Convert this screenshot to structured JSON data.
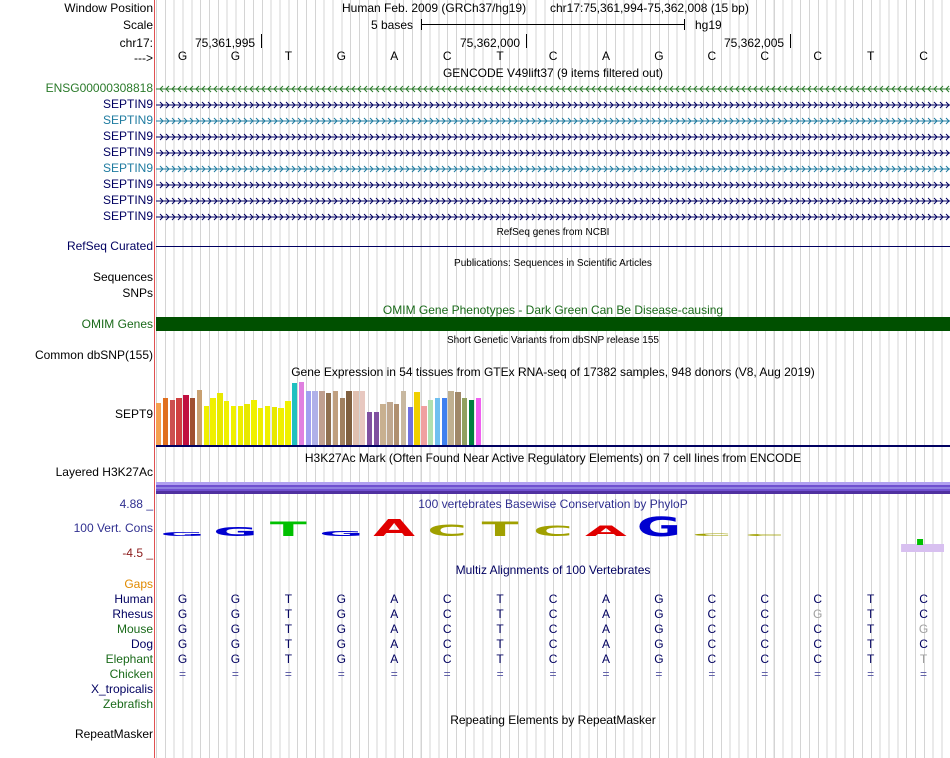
{
  "labels": {
    "window_position": "Window Position",
    "scale": "Scale",
    "chrom": "chr17:",
    "strand": "--->",
    "assembly": "Human Feb. 2009 (GRCh37/hg19)",
    "coords": "chr17:75,361,994-75,362,008 (15 bp)",
    "scale_text": "5 bases",
    "db": "hg19",
    "pos1": "75,361,995",
    "pos2": "75,362,000",
    "pos3": "75,362,005"
  },
  "sequence": [
    "G",
    "G",
    "T",
    "G",
    "A",
    "C",
    "T",
    "C",
    "A",
    "G",
    "C",
    "C",
    "C",
    "T",
    "C"
  ],
  "gencode": {
    "title": "GENCODE V49lift37 (9 items filtered out)",
    "items": [
      {
        "name": "ENSG00000308818",
        "color": "#2a7a2a"
      },
      {
        "name": "SEPTIN9",
        "color": "#000060"
      },
      {
        "name": "SEPTIN9",
        "color": "#1e7ba0"
      },
      {
        "name": "SEPTIN9",
        "color": "#000060"
      },
      {
        "name": "SEPTIN9",
        "color": "#000060"
      },
      {
        "name": "SEPTIN9",
        "color": "#1e7ba0"
      },
      {
        "name": "SEPTIN9",
        "color": "#000060"
      },
      {
        "name": "SEPTIN9",
        "color": "#000060"
      },
      {
        "name": "SEPTIN9",
        "color": "#000060"
      }
    ]
  },
  "refseq": {
    "title": "RefSeq genes from NCBI",
    "label": "RefSeq Curated"
  },
  "publications": {
    "title": "Publications: Sequences in Scientific Articles",
    "label1": "Sequences",
    "label2": "SNPs"
  },
  "omim": {
    "title": "OMIM Gene Phenotypes - Dark Green Can Be Disease-causing",
    "label": "OMIM Genes",
    "color": "#005000"
  },
  "dbsnp": {
    "title": "Short Genetic Variants from dbSNP release 155",
    "label": "Common dbSNP(155)"
  },
  "gtex": {
    "title": "Gene Expression in 54 tissues from GTEx RNA-seq of 17382 samples, 948 donors (V8, Aug 2019)",
    "label": "SEPT9",
    "bars": [
      {
        "h": 0.67,
        "c": "#f5a050"
      },
      {
        "h": 0.75,
        "c": "#e07020"
      },
      {
        "h": 0.72,
        "c": "#cc5050"
      },
      {
        "h": 0.75,
        "c": "#d04040"
      },
      {
        "h": 0.8,
        "c": "#c01040"
      },
      {
        "h": 0.75,
        "c": "#a05030"
      },
      {
        "h": 0.87,
        "c": "#c8a070"
      },
      {
        "h": 0.62,
        "c": "#f0f000"
      },
      {
        "h": 0.75,
        "c": "#f0f000"
      },
      {
        "h": 0.82,
        "c": "#e8e800"
      },
      {
        "h": 0.7,
        "c": "#f0f000"
      },
      {
        "h": 0.62,
        "c": "#f0f000"
      },
      {
        "h": 0.62,
        "c": "#eeee00"
      },
      {
        "h": 0.65,
        "c": "#e8e800"
      },
      {
        "h": 0.72,
        "c": "#f0f000"
      },
      {
        "h": 0.58,
        "c": "#eeee00"
      },
      {
        "h": 0.62,
        "c": "#f0f000"
      },
      {
        "h": 0.6,
        "c": "#e8e800"
      },
      {
        "h": 0.58,
        "c": "#f0f000"
      },
      {
        "h": 0.7,
        "c": "#f0f000"
      },
      {
        "h": 0.98,
        "c": "#20c0c0"
      },
      {
        "h": 1.0,
        "c": "#e080e0"
      },
      {
        "h": 0.85,
        "c": "#a0a0f0"
      },
      {
        "h": 0.86,
        "c": "#b0b0e8"
      },
      {
        "h": 0.85,
        "c": "#c0a090"
      },
      {
        "h": 0.82,
        "c": "#907050"
      },
      {
        "h": 0.85,
        "c": "#c0a080"
      },
      {
        "h": 0.75,
        "c": "#a08060"
      },
      {
        "h": 0.85,
        "c": "#806040"
      },
      {
        "h": 0.86,
        "c": "#e0c0b0"
      },
      {
        "h": 0.86,
        "c": "#e8c8c0"
      },
      {
        "h": 0.53,
        "c": "#8050a0"
      },
      {
        "h": 0.53,
        "c": "#8050a0"
      },
      {
        "h": 0.65,
        "c": "#c8b090"
      },
      {
        "h": 0.68,
        "c": "#c0a890"
      },
      {
        "h": 0.65,
        "c": "#b09070"
      },
      {
        "h": 0.85,
        "c": "#c8b8a0"
      },
      {
        "h": 0.6,
        "c": "#7070e0"
      },
      {
        "h": 0.84,
        "c": "#f0d000"
      },
      {
        "h": 0.62,
        "c": "#f0a0a0"
      },
      {
        "h": 0.72,
        "c": "#b0e0b0"
      },
      {
        "h": 0.75,
        "c": "#70c0f0"
      },
      {
        "h": 0.75,
        "c": "#4080f0"
      },
      {
        "h": 0.85,
        "c": "#c0b090"
      },
      {
        "h": 0.84,
        "c": "#a08868"
      },
      {
        "h": 0.75,
        "c": "#90a060"
      },
      {
        "h": 0.72,
        "c": "#008040"
      },
      {
        "h": 0.75,
        "c": "#f060f0"
      }
    ]
  },
  "h3k27ac": {
    "title": "H3K27Ac Mark (Often Found Near Active Regulatory Elements) on 7 cell lines from ENCODE",
    "label": "Layered H3K27Ac"
  },
  "phylop": {
    "title": "100 vertebrates Basewise Conservation by PhyloP",
    "label": "100 Vert. Cons",
    "max": "4.88 _",
    "min": "-4.5 _",
    "letters": [
      {
        "b": "G",
        "h": 0.15,
        "c": "#0000d0"
      },
      {
        "b": "G",
        "h": 0.35,
        "c": "#0000d0"
      },
      {
        "b": "T",
        "h": 0.55,
        "c": "#00c000"
      },
      {
        "b": "G",
        "h": 0.2,
        "c": "#0000d0"
      },
      {
        "b": "A",
        "h": 0.65,
        "c": "#e00000"
      },
      {
        "b": "C",
        "h": 0.45,
        "c": "#a0a000"
      },
      {
        "b": "T",
        "h": 0.55,
        "c": "#a0a000"
      },
      {
        "b": "C",
        "h": 0.4,
        "c": "#a0a000"
      },
      {
        "b": "A",
        "h": 0.4,
        "c": "#e00000"
      },
      {
        "b": "G",
        "h": 0.75,
        "c": "#0000d0"
      },
      {
        "b": "C",
        "h": 0.1,
        "c": "#a0a000"
      },
      {
        "b": "C",
        "h": 0.04,
        "c": "#a0a000"
      }
    ]
  },
  "multiz": {
    "title": "Multiz Alignments of 100 Vertebrates",
    "gaps_label": "Gaps",
    "species": [
      {
        "name": "Human",
        "color": "#000060",
        "seq": [
          "G",
          "G",
          "T",
          "G",
          "A",
          "C",
          "T",
          "C",
          "A",
          "G",
          "C",
          "C",
          "C",
          "T",
          "C"
        ]
      },
      {
        "name": "Rhesus",
        "color": "#000060",
        "seq": [
          "G",
          "G",
          "T",
          "G",
          "A",
          "C",
          "T",
          "C",
          "A",
          "G",
          "C",
          "C",
          "G",
          "T",
          "C"
        ]
      },
      {
        "name": "Mouse",
        "color": "#1a6a1a",
        "seq": [
          "G",
          "G",
          "T",
          "G",
          "A",
          "C",
          "T",
          "C",
          "A",
          "G",
          "C",
          "C",
          "C",
          "T",
          "G"
        ]
      },
      {
        "name": "Dog",
        "color": "#000060",
        "seq": [
          "G",
          "G",
          "T",
          "G",
          "A",
          "C",
          "T",
          "C",
          "A",
          "G",
          "C",
          "C",
          "C",
          "T",
          "C"
        ]
      },
      {
        "name": "Elephant",
        "color": "#1a6a1a",
        "seq": [
          "G",
          "G",
          "T",
          "G",
          "A",
          "C",
          "T",
          "C",
          "A",
          "G",
          "C",
          "C",
          "C",
          "T",
          "T"
        ]
      },
      {
        "name": "Chicken",
        "color": "#1a6a1a",
        "seq": [
          "=",
          "=",
          "=",
          "=",
          "=",
          "=",
          "=",
          "=",
          "=",
          "=",
          "=",
          "=",
          "=",
          "=",
          "="
        ]
      },
      {
        "name": "X_tropicalis",
        "color": "#000060",
        "seq": []
      },
      {
        "name": "Zebrafish",
        "color": "#1a6a1a",
        "seq": []
      }
    ]
  },
  "repeatmasker": {
    "title": "Repeating Elements by RepeatMasker",
    "label": "RepeatMasker"
  }
}
